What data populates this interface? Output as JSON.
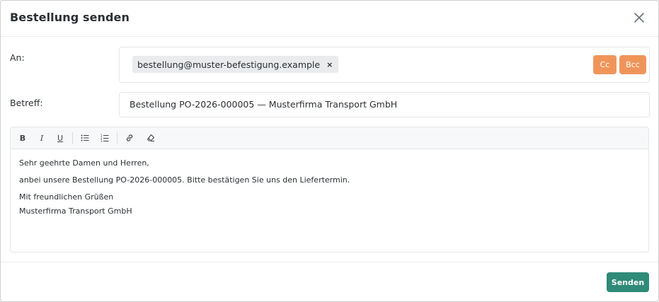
{
  "dialog": {
    "title": "Bestellung senden",
    "close_icon": "close-icon"
  },
  "to": {
    "label": "An:",
    "recipients": [
      {
        "email": "bestellung@muster-befestigung.example",
        "remove": "×"
      }
    ],
    "cc_label": "Cc",
    "bcc_label": "Bcc"
  },
  "subject": {
    "label": "Betreff:",
    "value": "Bestellung PO-2026-000005 — Musterfirma Transport GmbH"
  },
  "editor": {
    "toolbar": {
      "bold_label": "B",
      "italic_label": "I",
      "underline_label": "U",
      "icons": [
        "bold-icon",
        "italic-icon",
        "underline-icon",
        "bullet-list-icon",
        "numbered-list-icon",
        "link-icon",
        "clear-format-icon"
      ]
    },
    "body": {
      "line1": "Sehr geehrte Damen und Herren,",
      "line2": "anbei unsere Bestellung PO-2026-000005. Bitte bestätigen Sie uns den Liefertermin.",
      "line3": "Mit freundlichen Grüßen",
      "line4": "Musterfirma Transport GmbH"
    }
  },
  "footer": {
    "send_label": "Senden"
  },
  "colors": {
    "accent_orange": "#f0955a",
    "send_green": "#2f8a78"
  }
}
